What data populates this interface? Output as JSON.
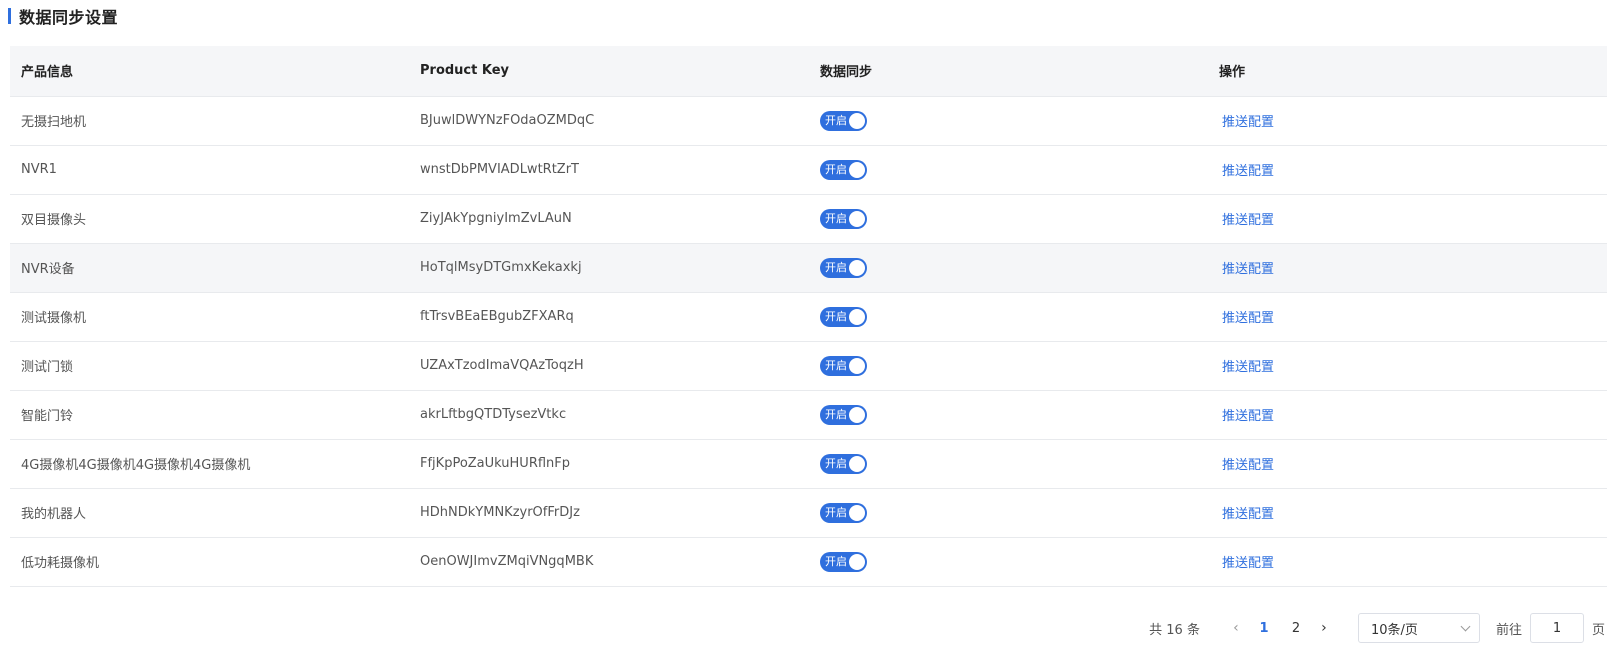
{
  "title": "数据同步设置",
  "table": {
    "columns": [
      "产品信息",
      "Product Key",
      "数据同步",
      "操作"
    ],
    "rows": [
      {
        "name": "无摄扫地机",
        "key": "BJuwlDWYNzFOdaOZMDqC",
        "sync": "开启",
        "action": "推送配置"
      },
      {
        "name": "NVR1",
        "key": "wnstDbPMVIADLwtRtZrT",
        "sync": "开启",
        "action": "推送配置"
      },
      {
        "name": "双目摄像头",
        "key": "ZiyJAkYpgniyImZvLAuN",
        "sync": "开启",
        "action": "推送配置"
      },
      {
        "name": "NVR设备",
        "key": "HoTqlMsyDTGmxKekaxkj",
        "sync": "开启",
        "action": "推送配置"
      },
      {
        "name": "测试摄像机",
        "key": "ftTrsvBEaEBgubZFXARq",
        "sync": "开启",
        "action": "推送配置"
      },
      {
        "name": "测试门锁",
        "key": "UZAxTzodImaVQAzToqzH",
        "sync": "开启",
        "action": "推送配置"
      },
      {
        "name": "智能门铃",
        "key": "akrLftbgQTDTysezVtkc",
        "sync": "开启",
        "action": "推送配置"
      },
      {
        "name": "4G摄像机4G摄像机4G摄像机4G摄像机",
        "key": "FfjKpPoZaUkuHURflnFp",
        "sync": "开启",
        "action": "推送配置"
      },
      {
        "name": "我的机器人",
        "key": "HDhNDkYMNKzyrOfFrDJz",
        "sync": "开启",
        "action": "推送配置"
      },
      {
        "name": "低功耗摄像机",
        "key": "OenOWJImvZMqiVNgqMBK",
        "sync": "开启",
        "action": "推送配置"
      }
    ],
    "highlighted_row": 3
  },
  "pagination": {
    "total_text": "共 16 条",
    "prev_icon": "chevron-left-icon",
    "next_icon": "chevron-right-icon",
    "pages": [
      "1",
      "2"
    ],
    "current_page": "1",
    "page_size": "10条/页",
    "goto_label": "前往",
    "goto_value": "1",
    "page_suffix": "页"
  },
  "colors": {
    "accent": "#2f6fde",
    "header_bg": "#f5f6f8",
    "border": "#e8eaed"
  }
}
